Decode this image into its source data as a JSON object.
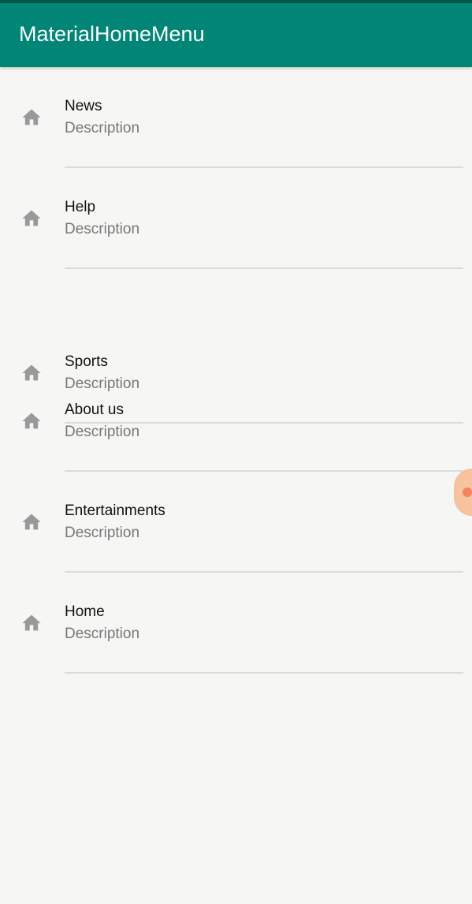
{
  "app_bar": {
    "title": "MaterialHomeMenu",
    "color": "#008577"
  },
  "menu": {
    "items": [
      {
        "title": "News",
        "description": "Description",
        "icon": "home-icon"
      },
      {
        "title": "Help",
        "description": "Description",
        "icon": "home-icon"
      },
      {
        "title": "Sports",
        "description": "Description",
        "icon": "home-icon"
      },
      {
        "title": "About us",
        "description": "Description",
        "icon": "home-icon"
      },
      {
        "title": "Entertainments",
        "description": "Description",
        "icon": "home-icon"
      },
      {
        "title": "Home",
        "description": "Description",
        "icon": "home-icon"
      }
    ]
  }
}
